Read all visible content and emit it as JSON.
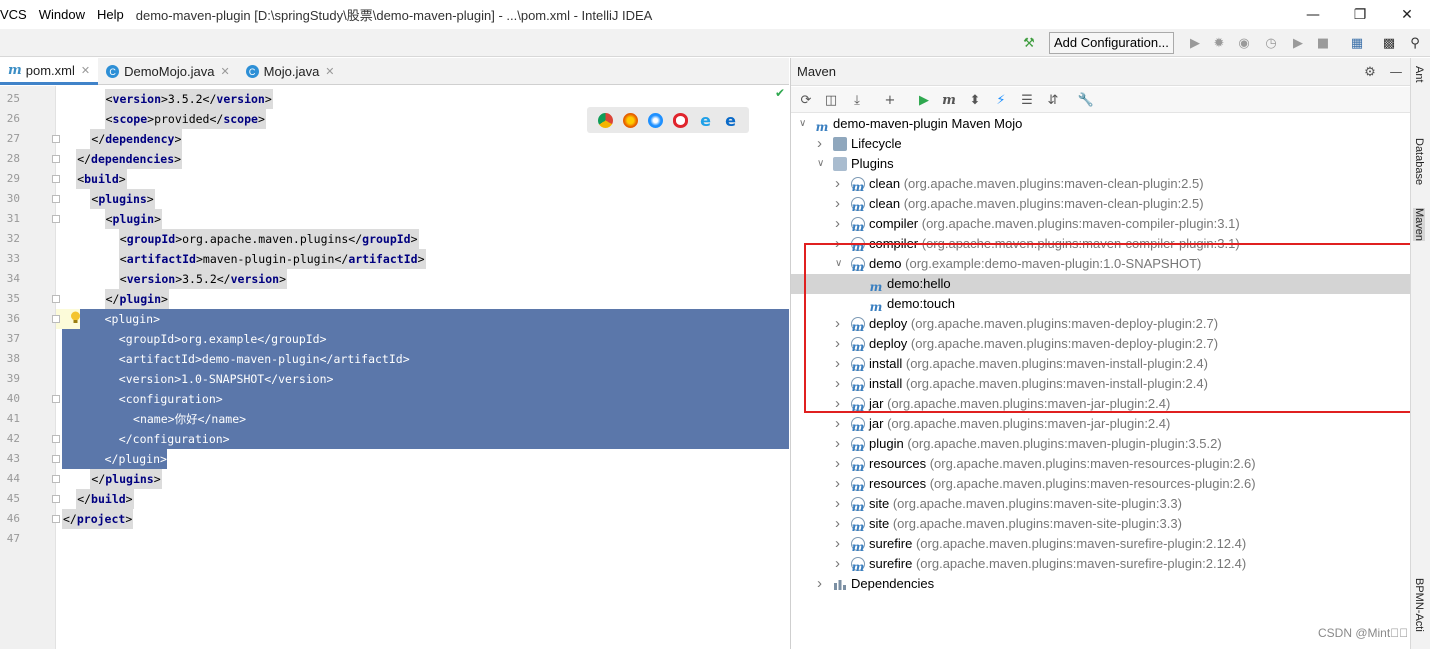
{
  "window": {
    "menu": [
      "VCS",
      "Window",
      "Help"
    ],
    "title": "demo-maven-plugin [D:\\springStudy\\股票\\demo-maven-plugin] - ...\\pom.xml - IntelliJ IDEA",
    "controls": [
      "minimize-icon",
      "maximize-icon",
      "close-icon"
    ]
  },
  "toolbar": {
    "add_configuration": "Add Configuration..."
  },
  "editor_tabs": [
    {
      "label": "pom.xml",
      "icon": "maven-file-icon",
      "active": true
    },
    {
      "label": "DemoMojo.java",
      "icon": "java-class-icon",
      "active": false
    },
    {
      "label": "Mojo.java",
      "icon": "java-class-icon",
      "active": false
    }
  ],
  "editor": {
    "lines": [
      {
        "num": "25",
        "indent": 3,
        "open": "version",
        "text": "3.5.2",
        "close": "version"
      },
      {
        "num": "26",
        "indent": 3,
        "open": "scope",
        "text": "provided",
        "close": "scope"
      },
      {
        "num": "27",
        "indent": 2,
        "close_only": "dependency"
      },
      {
        "num": "28",
        "indent": 1,
        "close_only": "dependencies"
      },
      {
        "num": "29",
        "indent": 1,
        "open_only": "build"
      },
      {
        "num": "30",
        "indent": 2,
        "open_only": "plugins"
      },
      {
        "num": "31",
        "indent": 3,
        "open_only": "plugin"
      },
      {
        "num": "32",
        "indent": 4,
        "open": "groupId",
        "text": "org.apache.maven.plugins",
        "close": "groupId"
      },
      {
        "num": "33",
        "indent": 4,
        "open": "artifactId",
        "text": "maven-plugin-plugin",
        "close": "artifactId"
      },
      {
        "num": "34",
        "indent": 4,
        "open": "version",
        "text": "3.5.2",
        "close": "version"
      },
      {
        "num": "35",
        "indent": 3,
        "close_only": "plugin"
      },
      {
        "num": "36",
        "indent": 3,
        "open_only": "plugin"
      },
      {
        "num": "37",
        "indent": 4,
        "open": "groupId",
        "text": "org.example",
        "close": "groupId"
      },
      {
        "num": "38",
        "indent": 4,
        "open": "artifactId",
        "text": "demo-maven-plugin",
        "close": "artifactId"
      },
      {
        "num": "39",
        "indent": 4,
        "open": "version",
        "text": "1.0-SNAPSHOT",
        "close": "version"
      },
      {
        "num": "40",
        "indent": 4,
        "open_only": "configuration"
      },
      {
        "num": "41",
        "indent": 5,
        "open": "name",
        "text": "你好",
        "close": "name"
      },
      {
        "num": "42",
        "indent": 4,
        "close_only": "configuration"
      },
      {
        "num": "43",
        "indent": 3,
        "close_only": "plugin"
      },
      {
        "num": "44",
        "indent": 2,
        "close_only": "plugins"
      },
      {
        "num": "45",
        "indent": 1,
        "close_only": "build"
      },
      {
        "num": "46",
        "indent": 0,
        "close_only": "project"
      },
      {
        "num": "47",
        "indent": 0
      }
    ]
  },
  "maven": {
    "title": "Maven",
    "tree": [
      {
        "depth": 0,
        "arrow": "down",
        "icon": "maven-project-icon",
        "name": "demo-maven-plugin Maven Mojo",
        "coord": ""
      },
      {
        "depth": 1,
        "arrow": "right",
        "icon": "lifecycle-icon",
        "name": "Lifecycle",
        "coord": ""
      },
      {
        "depth": 1,
        "arrow": "down",
        "icon": "plugins-folder-icon",
        "name": "Plugins",
        "coord": ""
      },
      {
        "depth": 2,
        "arrow": "right",
        "icon": "plugin-icon",
        "name": "clean",
        "coord": "(org.apache.maven.plugins:maven-clean-plugin:2.5)"
      },
      {
        "depth": 2,
        "arrow": "right",
        "icon": "plugin-icon",
        "name": "clean",
        "coord": "(org.apache.maven.plugins:maven-clean-plugin:2.5)"
      },
      {
        "depth": 2,
        "arrow": "right",
        "icon": "plugin-icon",
        "name": "compiler",
        "coord": "(org.apache.maven.plugins:maven-compiler-plugin:3.1)"
      },
      {
        "depth": 2,
        "arrow": "right",
        "icon": "plugin-icon",
        "name": "compiler",
        "coord": "(org.apache.maven.plugins:maven-compiler-plugin:3.1)"
      },
      {
        "depth": 2,
        "arrow": "down",
        "icon": "plugin-icon",
        "name": "demo",
        "coord": "(org.example:demo-maven-plugin:1.0-SNAPSHOT)"
      },
      {
        "depth": 3,
        "arrow": "",
        "icon": "goal-icon",
        "name": "demo:hello",
        "coord": "",
        "selected": true
      },
      {
        "depth": 3,
        "arrow": "",
        "icon": "goal-icon",
        "name": "demo:touch",
        "coord": ""
      },
      {
        "depth": 2,
        "arrow": "right",
        "icon": "plugin-icon",
        "name": "deploy",
        "coord": "(org.apache.maven.plugins:maven-deploy-plugin:2.7)"
      },
      {
        "depth": 2,
        "arrow": "right",
        "icon": "plugin-icon",
        "name": "deploy",
        "coord": "(org.apache.maven.plugins:maven-deploy-plugin:2.7)"
      },
      {
        "depth": 2,
        "arrow": "right",
        "icon": "plugin-icon",
        "name": "install",
        "coord": "(org.apache.maven.plugins:maven-install-plugin:2.4)"
      },
      {
        "depth": 2,
        "arrow": "right",
        "icon": "plugin-icon",
        "name": "install",
        "coord": "(org.apache.maven.plugins:maven-install-plugin:2.4)"
      },
      {
        "depth": 2,
        "arrow": "right",
        "icon": "plugin-icon",
        "name": "jar",
        "coord": "(org.apache.maven.plugins:maven-jar-plugin:2.4)"
      },
      {
        "depth": 2,
        "arrow": "right",
        "icon": "plugin-icon",
        "name": "jar",
        "coord": "(org.apache.maven.plugins:maven-jar-plugin:2.4)"
      },
      {
        "depth": 2,
        "arrow": "right",
        "icon": "plugin-icon",
        "name": "plugin",
        "coord": "(org.apache.maven.plugins:maven-plugin-plugin:3.5.2)"
      },
      {
        "depth": 2,
        "arrow": "right",
        "icon": "plugin-icon",
        "name": "resources",
        "coord": "(org.apache.maven.plugins:maven-resources-plugin:2.6)"
      },
      {
        "depth": 2,
        "arrow": "right",
        "icon": "plugin-icon",
        "name": "resources",
        "coord": "(org.apache.maven.plugins:maven-resources-plugin:2.6)"
      },
      {
        "depth": 2,
        "arrow": "right",
        "icon": "plugin-icon",
        "name": "site",
        "coord": "(org.apache.maven.plugins:maven-site-plugin:3.3)"
      },
      {
        "depth": 2,
        "arrow": "right",
        "icon": "plugin-icon",
        "name": "site",
        "coord": "(org.apache.maven.plugins:maven-site-plugin:3.3)"
      },
      {
        "depth": 2,
        "arrow": "right",
        "icon": "plugin-icon",
        "name": "surefire",
        "coord": "(org.apache.maven.plugins:maven-surefire-plugin:2.12.4)"
      },
      {
        "depth": 2,
        "arrow": "right",
        "icon": "plugin-icon",
        "name": "surefire",
        "coord": "(org.apache.maven.plugins:maven-surefire-plugin:2.12.4)"
      },
      {
        "depth": 1,
        "arrow": "right",
        "icon": "dependencies-icon",
        "name": "Dependencies",
        "coord": ""
      }
    ]
  },
  "right_stripe": [
    "Ant",
    "Database",
    "Maven",
    "BPMN-Acti"
  ],
  "watermark": "CSDN @Mint\u0000\u0000",
  "colors": {
    "selection": "#5b77aa",
    "highlight_box": "#e02020",
    "tag": "#000080",
    "maven_icon": "#3a7fc0"
  }
}
